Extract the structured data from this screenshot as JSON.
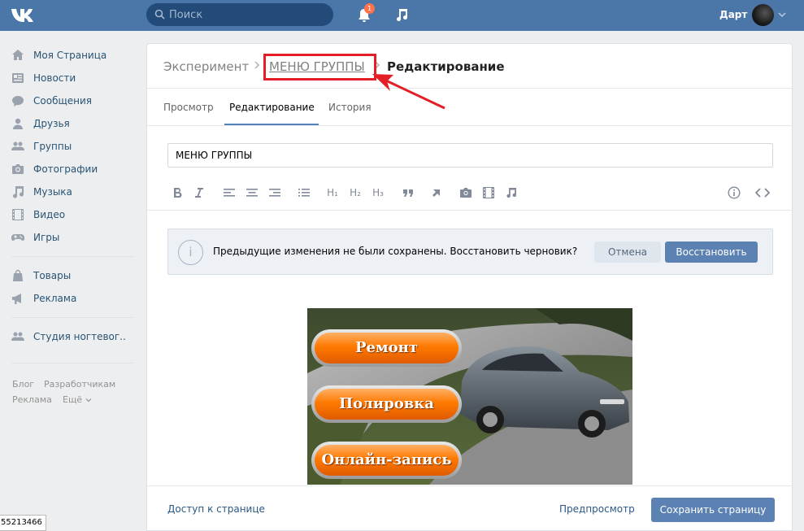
{
  "header": {
    "search_placeholder": "Поиск",
    "notification_count": "1",
    "user_name": "Дарт",
    "accent_color": "#4a76a8"
  },
  "sidebar": {
    "items": [
      {
        "label": "Моя Страница",
        "icon": "home-icon"
      },
      {
        "label": "Новости",
        "icon": "news-icon"
      },
      {
        "label": "Сообщения",
        "icon": "messages-icon"
      },
      {
        "label": "Друзья",
        "icon": "friends-icon"
      },
      {
        "label": "Группы",
        "icon": "groups-icon"
      },
      {
        "label": "Фотографии",
        "icon": "camera-icon"
      },
      {
        "label": "Музыка",
        "icon": "music-icon"
      },
      {
        "label": "Видео",
        "icon": "video-icon"
      },
      {
        "label": "Игры",
        "icon": "gamepad-icon"
      },
      {
        "label": "Товары",
        "icon": "bag-icon"
      },
      {
        "label": "Реклама",
        "icon": "megaphone-icon"
      },
      {
        "label": "Студия ногтевог..",
        "icon": "group-icon"
      }
    ],
    "footer": {
      "blog": "Блог",
      "developers": "Разработчикам",
      "ads": "Реклама",
      "more": "Ещё"
    }
  },
  "breadcrumbs": {
    "root": "Эксперимент",
    "page": "МЕНЮ ГРУППЫ",
    "current": "Редактирование"
  },
  "tabs": [
    {
      "label": "Просмотр"
    },
    {
      "label": "Редактирование"
    },
    {
      "label": "История"
    }
  ],
  "editor": {
    "title_value": "МЕНЮ ГРУППЫ",
    "toolbar": {
      "h1": "H₁",
      "h2": "H₂",
      "h3": "H₃"
    }
  },
  "draft_notice": {
    "text": "Предыдущие изменения не были сохранены. Восстановить черновик?",
    "cancel_label": "Отмена",
    "restore_label": "Восстановить"
  },
  "banner": {
    "buttons": [
      "Ремонт",
      "Полировка",
      "Онлайн-запись"
    ]
  },
  "bottom": {
    "access_label": "Доступ к странице",
    "preview_label": "Предпросмотр",
    "save_label": "Сохранить страницу"
  },
  "corner_text": "55213466"
}
